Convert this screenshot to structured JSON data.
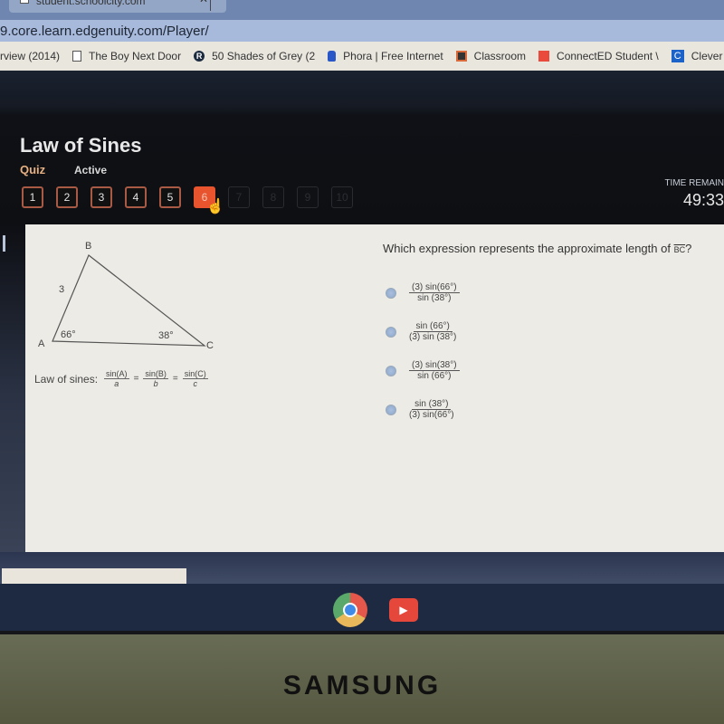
{
  "browser": {
    "tab_title": "student.schoolcity.com",
    "url": "9.core.learn.edgenuity.com/Player/",
    "bookmarks": [
      {
        "label": "rview (2014)",
        "icon": "none"
      },
      {
        "label": "The Boy Next Door",
        "icon": "page-icon"
      },
      {
        "label": "50 Shades of Grey (2",
        "icon": "r-logo-icon"
      },
      {
        "label": "Phora | Free Internet",
        "icon": "lock-icon"
      },
      {
        "label": "Classroom",
        "icon": "classroom-icon"
      },
      {
        "label": "ConnectED Student \\",
        "icon": "connected-icon"
      },
      {
        "label": "Clever",
        "icon": "clever-icon",
        "glyph": "C"
      }
    ]
  },
  "lesson": {
    "title": "Law of Sines",
    "type": "Quiz",
    "status": "Active",
    "questions": [
      {
        "label": "1",
        "state": "answered"
      },
      {
        "label": "2",
        "state": "answered"
      },
      {
        "label": "3",
        "state": "answered"
      },
      {
        "label": "4",
        "state": "answered"
      },
      {
        "label": "5",
        "state": "answered"
      },
      {
        "label": "6",
        "state": "current"
      },
      {
        "label": "7",
        "state": "locked"
      },
      {
        "label": "8",
        "state": "locked"
      },
      {
        "label": "9",
        "state": "locked"
      },
      {
        "label": "10",
        "state": "locked"
      }
    ],
    "time_label": "TIME REMAIN",
    "time_value": "49:33"
  },
  "diagram": {
    "vertices": {
      "A": "A",
      "B": "B",
      "C": "C"
    },
    "side_ab": "3",
    "angle_a": "66°",
    "angle_c": "38°"
  },
  "law_of_sines": {
    "label": "Law of sines:",
    "terms": [
      {
        "num": "sin(A)",
        "den": "a"
      },
      {
        "num": "sin(B)",
        "den": "b"
      },
      {
        "num": "sin(C)",
        "den": "c"
      }
    ],
    "equals": "="
  },
  "question": {
    "text": "Which expression represents the approximate length of ",
    "segment": "BC",
    "end": "?",
    "choices": [
      {
        "num": "(3) sin(66°)",
        "den": "sin (38°)"
      },
      {
        "num": "sin (66°)",
        "den": "(3) sin (38°)"
      },
      {
        "num": "(3) sin(38°)",
        "den": "sin (66°)"
      },
      {
        "num": "sin (38°)",
        "den": "(3) sin(66°)"
      }
    ]
  },
  "shelf": {
    "apps": [
      "chrome",
      "youtube"
    ],
    "youtube_glyph": "▶"
  },
  "device": {
    "brand": "SAMSUNG"
  },
  "colors": {
    "current_question": "#e7542e",
    "answered_border": "#a85a45",
    "quiz_label": "#e6b082",
    "radio": "#a9c0e0"
  }
}
